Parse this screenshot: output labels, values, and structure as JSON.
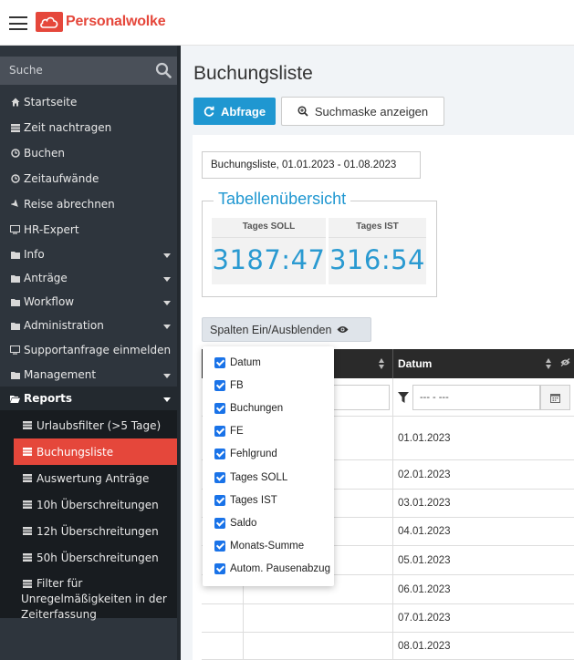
{
  "header": {
    "brand": "Personalwolke"
  },
  "sidebar": {
    "search_placeholder": "Suche",
    "items": [
      {
        "label": "Startseite",
        "icon": "home-icon"
      },
      {
        "label": "Zeit nachtragen",
        "icon": "table-icon"
      },
      {
        "label": "Buchen",
        "icon": "clock-icon"
      },
      {
        "label": "Zeitaufwände",
        "icon": "clock-icon"
      },
      {
        "label": "Reise abrechnen",
        "icon": "plane-icon"
      },
      {
        "label": "HR-Expert",
        "icon": "monitor-icon"
      },
      {
        "label": "Info",
        "icon": "folder-icon"
      },
      {
        "label": "Anträge",
        "icon": "folder-icon"
      },
      {
        "label": "Workflow",
        "icon": "folder-icon"
      },
      {
        "label": "Administration",
        "icon": "folder-icon"
      },
      {
        "label": "Supportanfrage einmelden",
        "icon": "monitor-icon"
      },
      {
        "label": "Management",
        "icon": "folder-icon"
      },
      {
        "label": "Reports",
        "icon": "folder-open-icon"
      }
    ],
    "reports_sub": [
      {
        "label": "Urlaubsfilter (>5 Tage)"
      },
      {
        "label": "Buchungsliste"
      },
      {
        "label": "Auswertung Anträge"
      },
      {
        "label": "10h Überschreitungen"
      },
      {
        "label": "12h Überschreitungen"
      },
      {
        "label": "50h Überschreitungen"
      },
      {
        "label_line1": "Filter für",
        "label_line2": "Unregelmäßigkeiten in der",
        "label_line3": "Zeiterfassung"
      }
    ]
  },
  "main": {
    "title": "Buchungsliste",
    "query_button": "Abfrage",
    "search_mask_button": "Suchmaske anzeigen",
    "caption": "Buchungsliste, 01.01.2023 - 01.08.2023",
    "overview_title": "Tabellenübersicht",
    "stats": [
      {
        "label": "Tages SOLL",
        "value": "3187:47"
      },
      {
        "label": "Tages IST",
        "value": "316:54"
      }
    ],
    "columns_toggle": "Spalten Ein/Ausblenden",
    "table": {
      "date_header": "Datum",
      "date_filter_placeholder": "--- - ---",
      "rows": [
        "01.01.2023",
        "02.01.2023",
        "03.01.2023",
        "04.01.2023",
        "05.01.2023",
        "06.01.2023",
        "07.01.2023",
        "08.01.2023"
      ]
    },
    "column_menu": [
      "Datum",
      "FB",
      "Buchungen",
      "FE",
      "Fehlgrund",
      "Tages SOLL",
      "Tages IST",
      "Saldo",
      "Monats-Summe",
      "Autom. Pausenabzug"
    ]
  }
}
